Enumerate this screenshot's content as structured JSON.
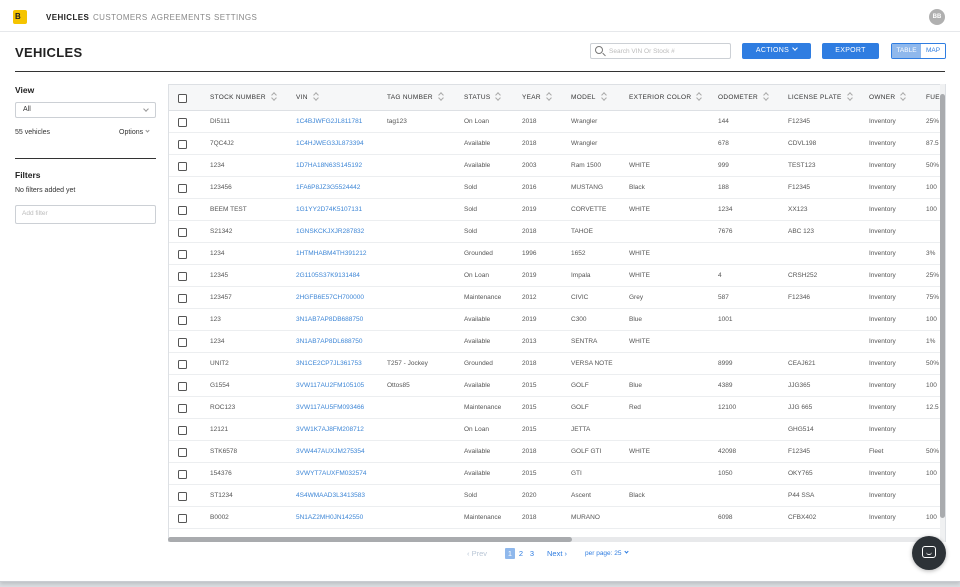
{
  "nav": {
    "logo_letter": "B",
    "items": [
      {
        "label": "VEHICLES",
        "active": true
      },
      {
        "label": "CUSTOMERS",
        "active": false
      },
      {
        "label": "AGREEMENTS",
        "active": false
      },
      {
        "label": "SETTINGS",
        "active": false
      }
    ],
    "avatar_initials": "BB"
  },
  "page": {
    "title": "VEHICLES",
    "search_placeholder": "Search VIN Or Stock #",
    "actions_label": "ACTIONS",
    "export_label": "EXPORT",
    "view_toggle": {
      "table": "TABLE",
      "map": "MAP",
      "selected": "TABLE"
    }
  },
  "sidebar": {
    "view_heading": "View",
    "view_selected": "All",
    "vehicle_count": "55 vehicles",
    "options_label": "Options",
    "filters_heading": "Filters",
    "no_filters": "No filters added yet",
    "add_filter_placeholder": "Add filter"
  },
  "table": {
    "columns": [
      "STOCK NUMBER",
      "VIN",
      "TAG NUMBER",
      "STATUS",
      "YEAR",
      "MODEL",
      "EXTERIOR COLOR",
      "ODOMETER",
      "LICENSE PLATE",
      "OWNER",
      "FUEL"
    ],
    "rows": [
      [
        "DI5111",
        "1C4BJWFG2JL811781",
        "tag123",
        "On Loan",
        "2018",
        "Wrangler",
        "",
        "144",
        "F12345",
        "Inventory",
        "25%"
      ],
      [
        "7QC4J2",
        "1C4HJWEG3JL873394",
        "",
        "Available",
        "2018",
        "Wrangler",
        "",
        "678",
        "CDVL198",
        "Inventory",
        "87.5"
      ],
      [
        "1234",
        "1D7HA18N63S145192",
        "",
        "Available",
        "2003",
        "Ram 1500",
        "WHITE",
        "999",
        "TEST123",
        "Inventory",
        "50%"
      ],
      [
        "123456",
        "1FA6P8JZ3G5524442",
        "",
        "Sold",
        "2016",
        "MUSTANG",
        "Black",
        "188",
        "F12345",
        "Inventory",
        "100"
      ],
      [
        "BEEM TEST",
        "1G1YY2D74K5107131",
        "",
        "Sold",
        "2019",
        "CORVETTE",
        "WHITE",
        "1234",
        "XX123",
        "Inventory",
        "100"
      ],
      [
        "S21342",
        "1GNSKCKJXJR287832",
        "",
        "Sold",
        "2018",
        "TAHOE",
        "",
        "7676",
        "ABC 123",
        "Inventory",
        ""
      ],
      [
        "1234",
        "1HTMHABM4TH391212",
        "",
        "Grounded",
        "1996",
        "1652",
        "WHITE",
        "",
        "",
        "Inventory",
        "3%"
      ],
      [
        "12345",
        "2G1105S37K9131484",
        "",
        "On Loan",
        "2019",
        "Impala",
        "WHITE",
        "4",
        "CRSH252",
        "Inventory",
        "25%"
      ],
      [
        "123457",
        "2HGFB6E57CH700000",
        "",
        "Maintenance",
        "2012",
        "CIVIC",
        "Grey",
        "587",
        "F12346",
        "Inventory",
        "75%"
      ],
      [
        "123",
        "3N1AB7AP8DB688750",
        "",
        "Available",
        "2019",
        "C300",
        "Blue",
        "1001",
        "",
        "Inventory",
        "100"
      ],
      [
        "1234",
        "3N1AB7AP8DL688750",
        "",
        "Available",
        "2013",
        "SENTRA",
        "WHITE",
        "",
        "",
        "Inventory",
        "1%"
      ],
      [
        "UNIT2",
        "3N1CE2CP7JL361753",
        "T257 - Jockey",
        "Grounded",
        "2018",
        "VERSA NOTE",
        "",
        "8999",
        "CEAJ621",
        "Inventory",
        "50%"
      ],
      [
        "G1554",
        "3VW117AU2FM105105",
        "Ottos85",
        "Available",
        "2015",
        "GOLF",
        "Blue",
        "4389",
        "JJG365",
        "Inventory",
        "100"
      ],
      [
        "ROC123",
        "3VW117AU5FM093466",
        "",
        "Maintenance",
        "2015",
        "GOLF",
        "Red",
        "12100",
        "JJG 665",
        "Inventory",
        "12.5"
      ],
      [
        "12121",
        "3VW1K7AJ8FM208712",
        "",
        "On Loan",
        "2015",
        "JETTA",
        "",
        "",
        "GHG514",
        "Inventory",
        ""
      ],
      [
        "STK6578",
        "3VW447AUXJM275354",
        "",
        "Available",
        "2018",
        "GOLF GTI",
        "WHITE",
        "42098",
        "F12345",
        "Fleet",
        "50%"
      ],
      [
        "154376",
        "3VWYT7AUXFM032574",
        "",
        "Available",
        "2015",
        "GTI",
        "",
        "1050",
        "OKY765",
        "Inventory",
        "100"
      ],
      [
        "ST1234",
        "4S4WMAAD3L3413583",
        "",
        "Sold",
        "2020",
        "Ascent",
        "Black",
        "",
        "P44 SSA",
        "Inventory",
        ""
      ],
      [
        "B0002",
        "5N1AZ2MH0JN142550",
        "",
        "Maintenance",
        "2018",
        "MURANO",
        "",
        "6098",
        "CFBX402",
        "Inventory",
        "100"
      ]
    ]
  },
  "pagination": {
    "prev_label": "Prev",
    "pages": [
      "1",
      "2",
      "3"
    ],
    "current_page": "1",
    "next_label": "Next",
    "per_page_label": "per page: 25"
  },
  "colors": {
    "accent": "#2f7de1",
    "link": "#3d86d6",
    "logo": "#f5c400"
  }
}
